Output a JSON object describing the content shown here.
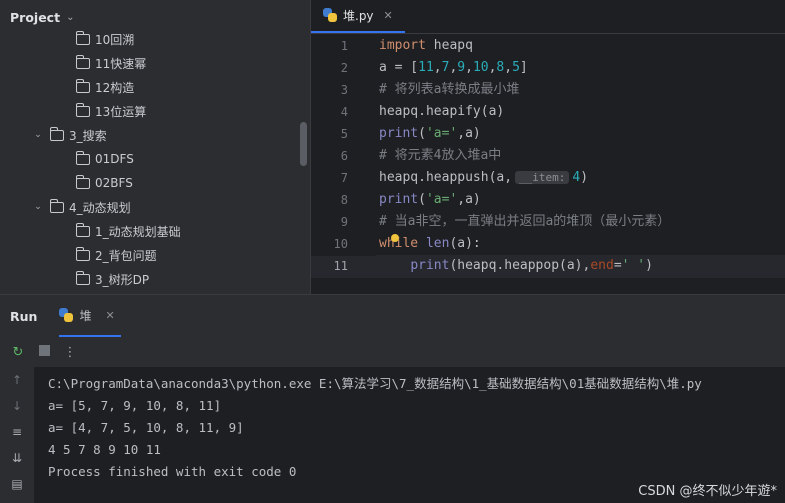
{
  "project": {
    "title": "Project",
    "items": [
      {
        "label": "10回溯",
        "level": 3,
        "expandable": false
      },
      {
        "label": "11快速幂",
        "level": 3,
        "expandable": false
      },
      {
        "label": "12构造",
        "level": 3,
        "expandable": false
      },
      {
        "label": "13位运算",
        "level": 3,
        "expandable": false
      },
      {
        "label": "3_搜索",
        "level": 2,
        "expandable": true
      },
      {
        "label": "01DFS",
        "level": 3,
        "expandable": false
      },
      {
        "label": "02BFS",
        "level": 3,
        "expandable": false
      },
      {
        "label": "4_动态规划",
        "level": 2,
        "expandable": true
      },
      {
        "label": "1_动态规划基础",
        "level": 3,
        "expandable": false
      },
      {
        "label": "2_背包问题",
        "level": 3,
        "expandable": false
      },
      {
        "label": "3_树形DP",
        "level": 3,
        "expandable": false
      }
    ]
  },
  "editor": {
    "tab_label": "堆.py",
    "close_glyph": "✕",
    "current_line": 11,
    "hint_label": "__item:",
    "lines": [
      [
        {
          "t": "import",
          "c": "kw"
        },
        {
          "t": " heapq",
          "c": ""
        }
      ],
      [
        {
          "t": "a = [",
          "c": ""
        },
        {
          "t": "11",
          "c": "num"
        },
        {
          "t": ",",
          "c": ""
        },
        {
          "t": "7",
          "c": "num"
        },
        {
          "t": ",",
          "c": ""
        },
        {
          "t": "9",
          "c": "num"
        },
        {
          "t": ",",
          "c": ""
        },
        {
          "t": "10",
          "c": "num"
        },
        {
          "t": ",",
          "c": ""
        },
        {
          "t": "8",
          "c": "num"
        },
        {
          "t": ",",
          "c": ""
        },
        {
          "t": "5",
          "c": "num"
        },
        {
          "t": "]",
          "c": ""
        }
      ],
      [
        {
          "t": "# 将列表a转换成最小堆",
          "c": "cm"
        }
      ],
      [
        {
          "t": "heapq.heapify(a)",
          "c": ""
        }
      ],
      [
        {
          "t": "print",
          "c": "bi"
        },
        {
          "t": "(",
          "c": ""
        },
        {
          "t": "'a='",
          "c": "str"
        },
        {
          "t": ",a)",
          "c": ""
        }
      ],
      [
        {
          "t": "# 将元素4放入堆a中",
          "c": "cm"
        }
      ],
      [
        {
          "t": "heapq.heappush(a,",
          "c": ""
        },
        {
          "t": "HINT",
          "c": "hint"
        },
        {
          "t": "4",
          "c": "num"
        },
        {
          "t": ")",
          "c": ""
        }
      ],
      [
        {
          "t": "print",
          "c": "bi"
        },
        {
          "t": "(",
          "c": ""
        },
        {
          "t": "'a='",
          "c": "str"
        },
        {
          "t": ",a)",
          "c": ""
        }
      ],
      [
        {
          "t": "# 当a非空，一直弹出并返回a的堆顶（最小元素）",
          "c": "cm"
        }
      ],
      [
        {
          "t": "while ",
          "c": "kw"
        },
        {
          "t": "len",
          "c": "bi"
        },
        {
          "t": "(a):",
          "c": ""
        }
      ],
      [
        {
          "t": "    ",
          "c": ""
        },
        {
          "t": "print",
          "c": "bi"
        },
        {
          "t": "(heapq.heappop(a),",
          "c": ""
        },
        {
          "t": "end",
          "c": "param"
        },
        {
          "t": "=",
          "c": ""
        },
        {
          "t": "' '",
          "c": "str"
        },
        {
          "t": ")",
          "c": ""
        }
      ]
    ]
  },
  "run": {
    "title": "Run",
    "tab_label": "堆",
    "close_glyph": "✕",
    "output": [
      "C:\\ProgramData\\anaconda3\\python.exe E:\\算法学习\\7_数据结构\\1_基础数据结构\\01基础数据结构\\堆.py",
      "a= [5, 7, 9, 10, 8, 11]",
      "a= [4, 7, 5, 10, 8, 11, 9]",
      "4 5 7 8 9 10 11",
      "Process finished with exit code 0"
    ]
  },
  "watermark": "CSDN @终不似少年遊*",
  "colors": {
    "accent": "#3574f0",
    "keyword": "#cf8e6d",
    "string": "#6aab73",
    "number": "#2aacb8",
    "comment": "#7a7e85",
    "builtin": "#8888c6"
  }
}
